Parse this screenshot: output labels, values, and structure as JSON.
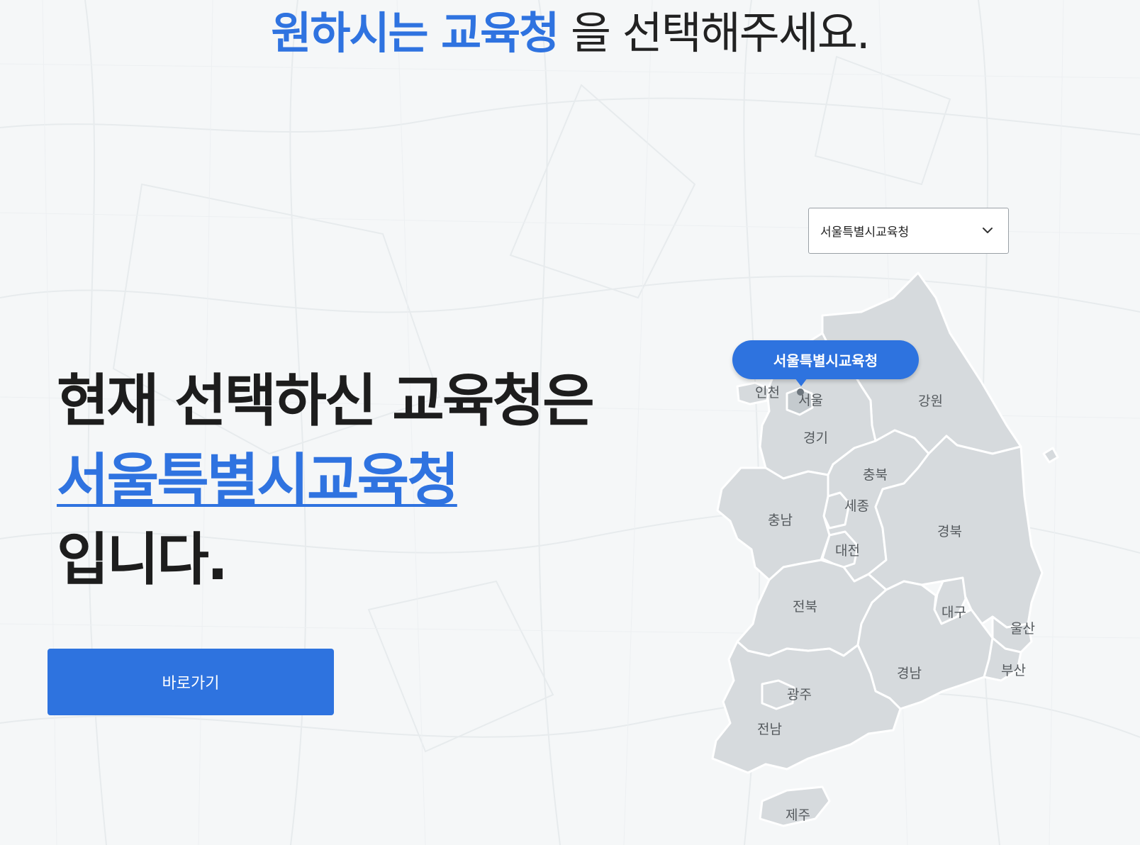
{
  "heading": {
    "highlight": "원하시는 교육청",
    "rest": " 을 선택해주세요."
  },
  "selected": {
    "line1": "현재 선택하신 교육청은",
    "office": "서울특별시교육청",
    "line3": "입니다."
  },
  "go_button_label": "바로가기",
  "select": {
    "value": "서울특별시교육청",
    "icon": "chevron-down-icon"
  },
  "map": {
    "tooltip": "서울특별시교육청",
    "regions": {
      "incheon": "인천",
      "seoul": "서울",
      "gangwon": "강원",
      "gyeonggi": "경기",
      "chungbuk": "충북",
      "sejong": "세종",
      "chungnam": "충남",
      "daejeon": "대전",
      "gyeongbuk": "경북",
      "jeonbuk": "전북",
      "daegu": "대구",
      "ulsan": "울산",
      "busan": "부산",
      "gyeongnam": "경남",
      "gwangju": "광주",
      "jeonnam": "전남",
      "jeju": "제주"
    }
  },
  "colors": {
    "accent": "#2e73df",
    "region_fill": "#d6dadd",
    "region_stroke": "#ffffff",
    "background": "#f5f7f8"
  }
}
